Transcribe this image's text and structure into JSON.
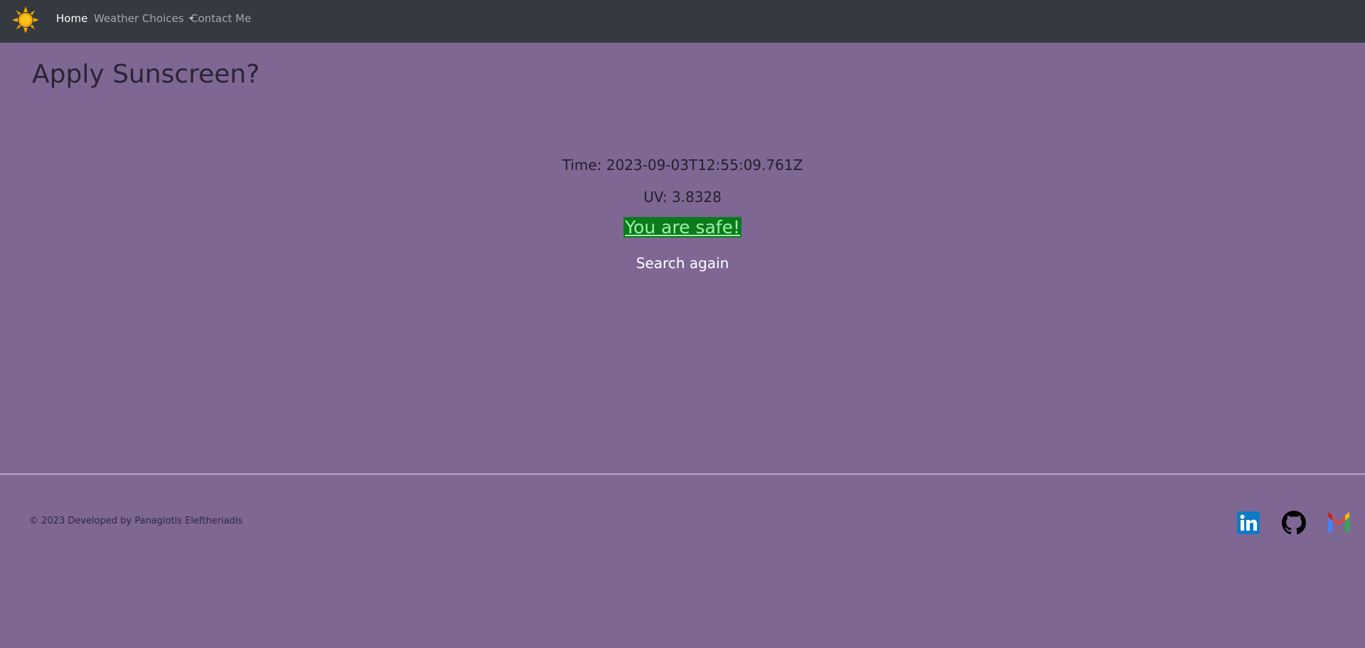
{
  "navbar": {
    "brand_icon": "sun-icon",
    "links": [
      {
        "label": "Home",
        "active": true
      },
      {
        "label": "Weather Choices",
        "active": false,
        "dropdown": true
      },
      {
        "label": "Contact Me",
        "active": false
      }
    ]
  },
  "main": {
    "title": "Apply Sunscreen?",
    "time": "Time: 2023-09-03T12:55:09.761Z",
    "uv": "UV: 3.8328",
    "status": "You are safe!",
    "search_again": "Search again"
  },
  "footer": {
    "copyright": "© 2023 Developed by Panagiotis Eleftheriadis",
    "social_icons": [
      "linkedin-icon",
      "github-icon",
      "gmail-icon"
    ]
  },
  "colors": {
    "background": "#7f6794",
    "navbar": "#343a40",
    "safe_badge_bg": "#0b7a1c",
    "safe_badge_text": "#9df2a6"
  }
}
